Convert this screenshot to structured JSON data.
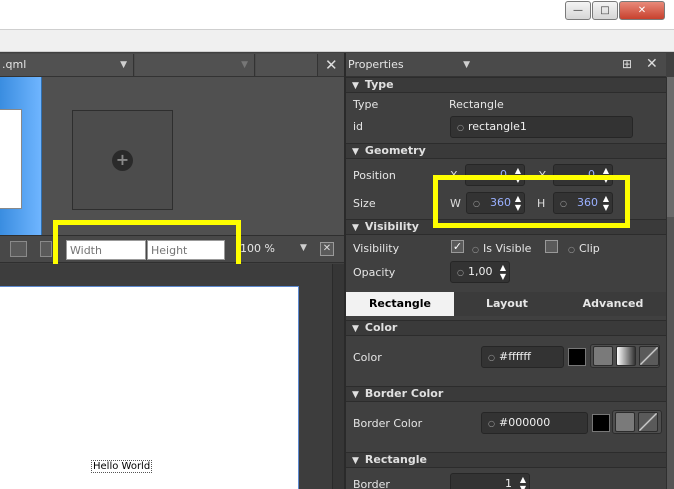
{
  "editor": {
    "file_combo": ".qml",
    "toolbar": {
      "width_placeholder": "Width",
      "height_placeholder": "Height",
      "zoom": "100 %"
    },
    "canvas_text": "Hello World"
  },
  "properties": {
    "title": "Properties",
    "sections": {
      "type": "Type",
      "geometry": "Geometry",
      "visibility": "Visibility",
      "color": "Color",
      "border_color": "Border Color",
      "rectangle": "Rectangle"
    },
    "type_label": "Type",
    "type_value": "Rectangle",
    "id_label": "id",
    "id_value": "rectangle1",
    "position_label": "Position",
    "x_label": "X",
    "y_label": "Y",
    "x_value": "0",
    "y_value": "0",
    "size_label": "Size",
    "w_label": "W",
    "h_label": "H",
    "w_value": "360",
    "h_value": "360",
    "visibility_label": "Visibility",
    "is_visible_label": "Is Visible",
    "is_visible_checked": true,
    "clip_label": "Clip",
    "clip_checked": false,
    "opacity_label": "Opacity",
    "opacity_value": "1,00",
    "tabs": [
      "Rectangle",
      "Layout",
      "Advanced"
    ],
    "active_tab": "Rectangle",
    "color_label": "Color",
    "color_value": "#ffffff",
    "border_color_label": "Border Color",
    "border_color_value": "#000000",
    "border_label": "Border",
    "border_value": "1"
  },
  "colors": {
    "highlight": "#ffff00",
    "fill_color": "#ffffff",
    "border_color": "#000000",
    "spin_number": "#9ab0ff"
  }
}
